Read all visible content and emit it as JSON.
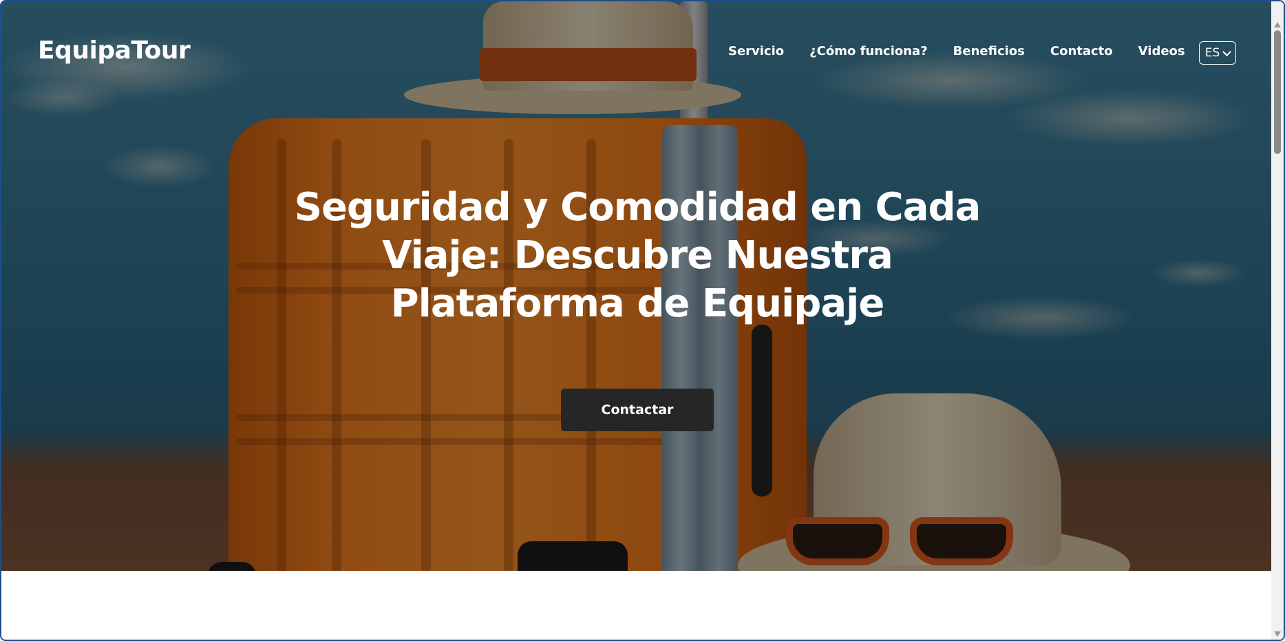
{
  "brand": {
    "name": "EquipaTour"
  },
  "nav": {
    "items": [
      {
        "label": "Servicio"
      },
      {
        "label": "¿Cómo funciona?"
      },
      {
        "label": "Beneficios"
      },
      {
        "label": "Contacto"
      },
      {
        "label": "Videos"
      }
    ],
    "language": {
      "selected": "ES",
      "icon": "chevron-down-icon"
    }
  },
  "hero": {
    "headline": "Seguridad y Comodidad en Cada Viaje: Descubre Nuestra Plataforma de Equipaje",
    "cta_label": "Contactar"
  },
  "colors": {
    "cta_background": "#262626",
    "nav_text": "#ffffff",
    "window_border": "#1d4f8f"
  }
}
